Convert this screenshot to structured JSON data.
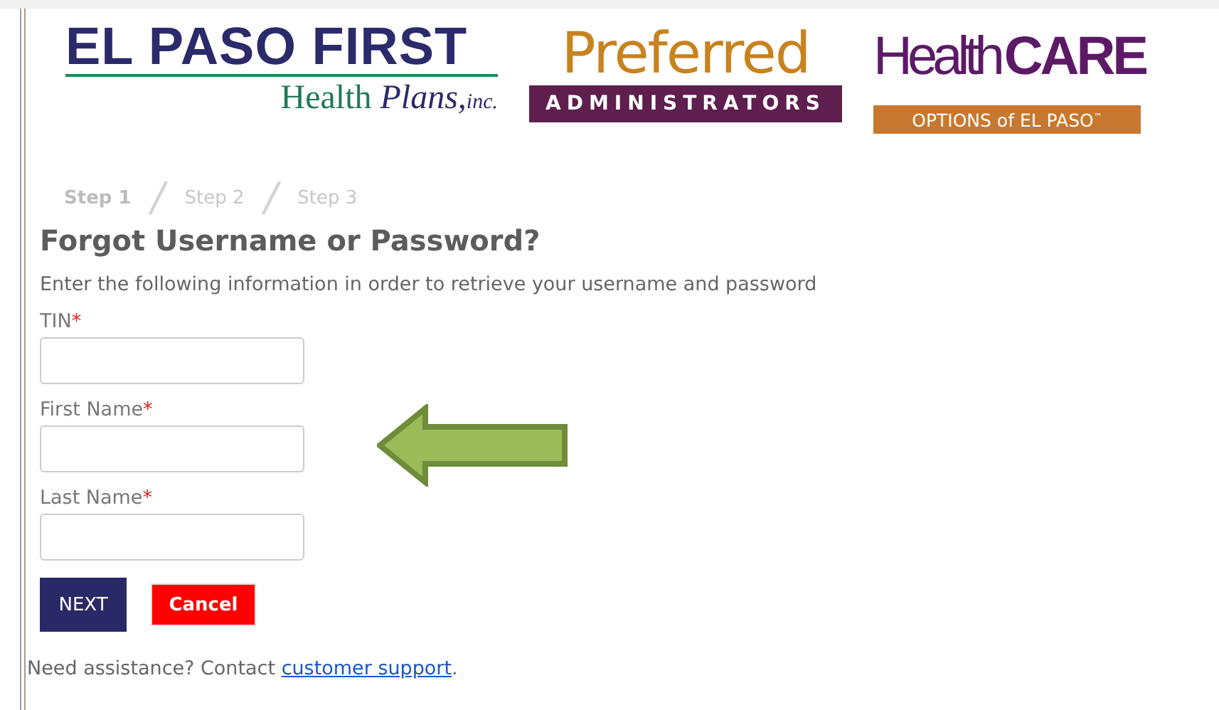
{
  "logos": [
    {
      "kind": "epf",
      "title": "EL PASO FIRST",
      "sub_a": "Health",
      "sub_b": "Plans,",
      "sub_c": "inc."
    },
    {
      "kind": "preferred",
      "title": "Preferred",
      "band": "ADMINISTRATORS"
    },
    {
      "kind": "healthcare",
      "title_a": "Health",
      "title_b": "CARE",
      "band": "OPTIONS of EL PASO",
      "mark": "™"
    }
  ],
  "steps": [
    {
      "label": "Step 1",
      "selected": true
    },
    {
      "label": "Step 2",
      "selected": false
    },
    {
      "label": "Step 3",
      "selected": false
    }
  ],
  "step_separator": "/",
  "heading": "Forgot Username or Password?",
  "description": "Enter the following information in order to retrieve your username and password",
  "fields": [
    {
      "label": "TIN",
      "required": true
    },
    {
      "label": "First Name",
      "required": true
    },
    {
      "label": "Last Name",
      "required": true
    }
  ],
  "required_mark": "*",
  "buttons": [
    {
      "label": "NEXT",
      "kind": "primary"
    },
    {
      "label": "Cancel",
      "kind": "danger"
    }
  ],
  "footer": {
    "text": "Need assistance? Contact ",
    "link": "customer support",
    "end": "."
  }
}
